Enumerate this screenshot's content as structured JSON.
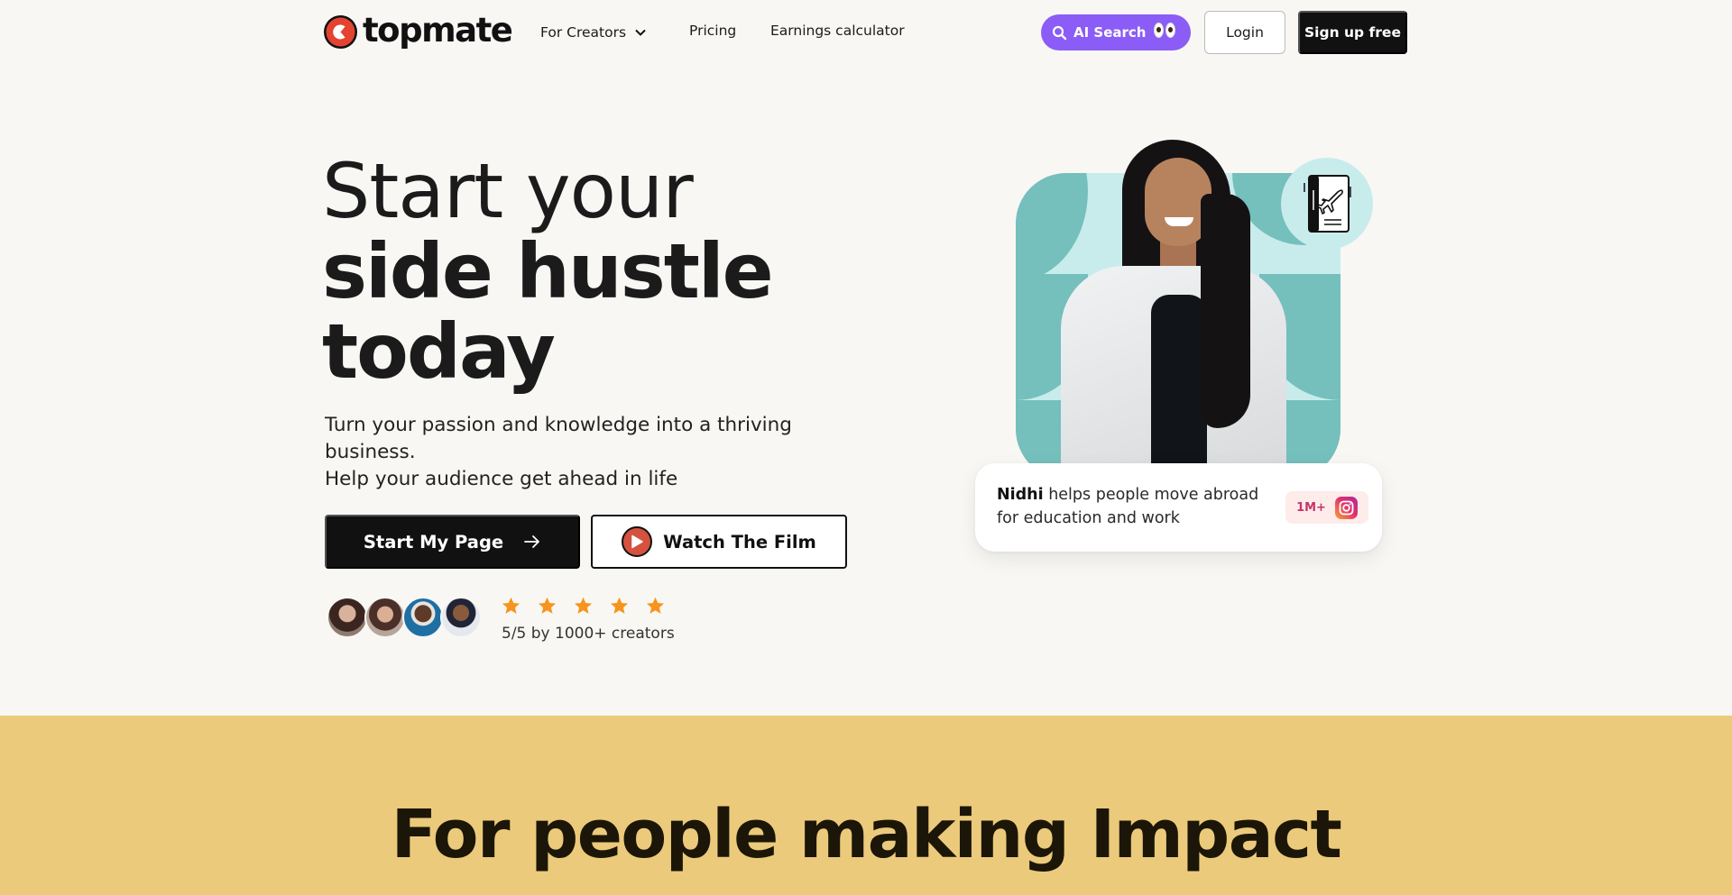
{
  "nav": {
    "logo_text": "topmate",
    "links": [
      {
        "label": "For Creators",
        "has_dropdown": true
      },
      {
        "label": "Pricing"
      },
      {
        "label": "Earnings calculator"
      }
    ],
    "ai_search_label": "AI Search",
    "login_label": "Login",
    "signup_label": "Sign up free"
  },
  "hero": {
    "headline_light": "Start your",
    "headline_bold_1": "side hustle",
    "headline_bold_2": "today",
    "subtitle_line_1": "Turn your passion and knowledge into a thriving business.",
    "subtitle_line_2": "Help your audience get ahead in life",
    "cta_primary": "Start My Page",
    "cta_secondary": "Watch The Film",
    "rating": {
      "stars": 5,
      "max": 5,
      "text": "5/5 by 1000+ creators"
    },
    "creator_card": {
      "name": "Nidhi",
      "description": " helps people move abroad for education and work",
      "followers": "1M+",
      "platform_icon": "instagram-icon"
    }
  },
  "section_impact": {
    "title_light": "For people ",
    "title_bold": "making Impact"
  },
  "colors": {
    "background": "#f8f7f4",
    "ai_search": "#8b5cf6",
    "primary_button": "#111111",
    "brand_red": "#e44332",
    "star": "#f7941d",
    "teal_light": "#c8eceb",
    "teal_dark": "#75bfbc",
    "impact_section": "#ecca7b",
    "followers_text": "#c8336b"
  }
}
